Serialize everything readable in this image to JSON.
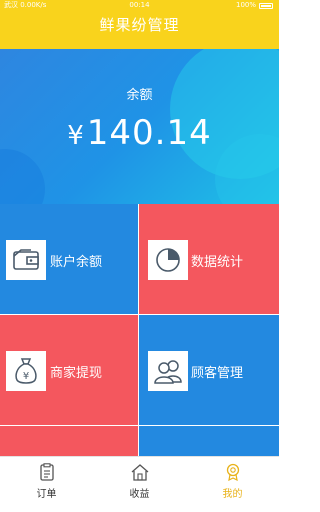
{
  "status_bar": {
    "carrier": "武汉 0.00K/s",
    "time": "00:14",
    "battery": "100%"
  },
  "header": {
    "title": "鲜果纷管理"
  },
  "balance": {
    "label": "余额",
    "currency": "¥",
    "amount": "140.14"
  },
  "tiles": [
    {
      "label": "账户余额",
      "icon": "wallet-icon",
      "color": "#2389e0"
    },
    {
      "label": "数据统计",
      "icon": "pie-chart-icon",
      "color": "#f4575e"
    },
    {
      "label": "商家提现",
      "icon": "money-bag-icon",
      "color": "#f4575e"
    },
    {
      "label": "顾客管理",
      "icon": "users-icon",
      "color": "#2389e0"
    }
  ],
  "tabbar": {
    "items": [
      {
        "label": "订单",
        "icon": "order-list-icon",
        "active": false
      },
      {
        "label": "收益",
        "icon": "home-icon",
        "active": false
      },
      {
        "label": "我的",
        "icon": "medal-icon",
        "active": true
      }
    ]
  },
  "colors": {
    "header": "#f9d31c",
    "tile_blue": "#2389e0",
    "tile_red": "#f4575e",
    "active_tab": "#e8b21a"
  }
}
